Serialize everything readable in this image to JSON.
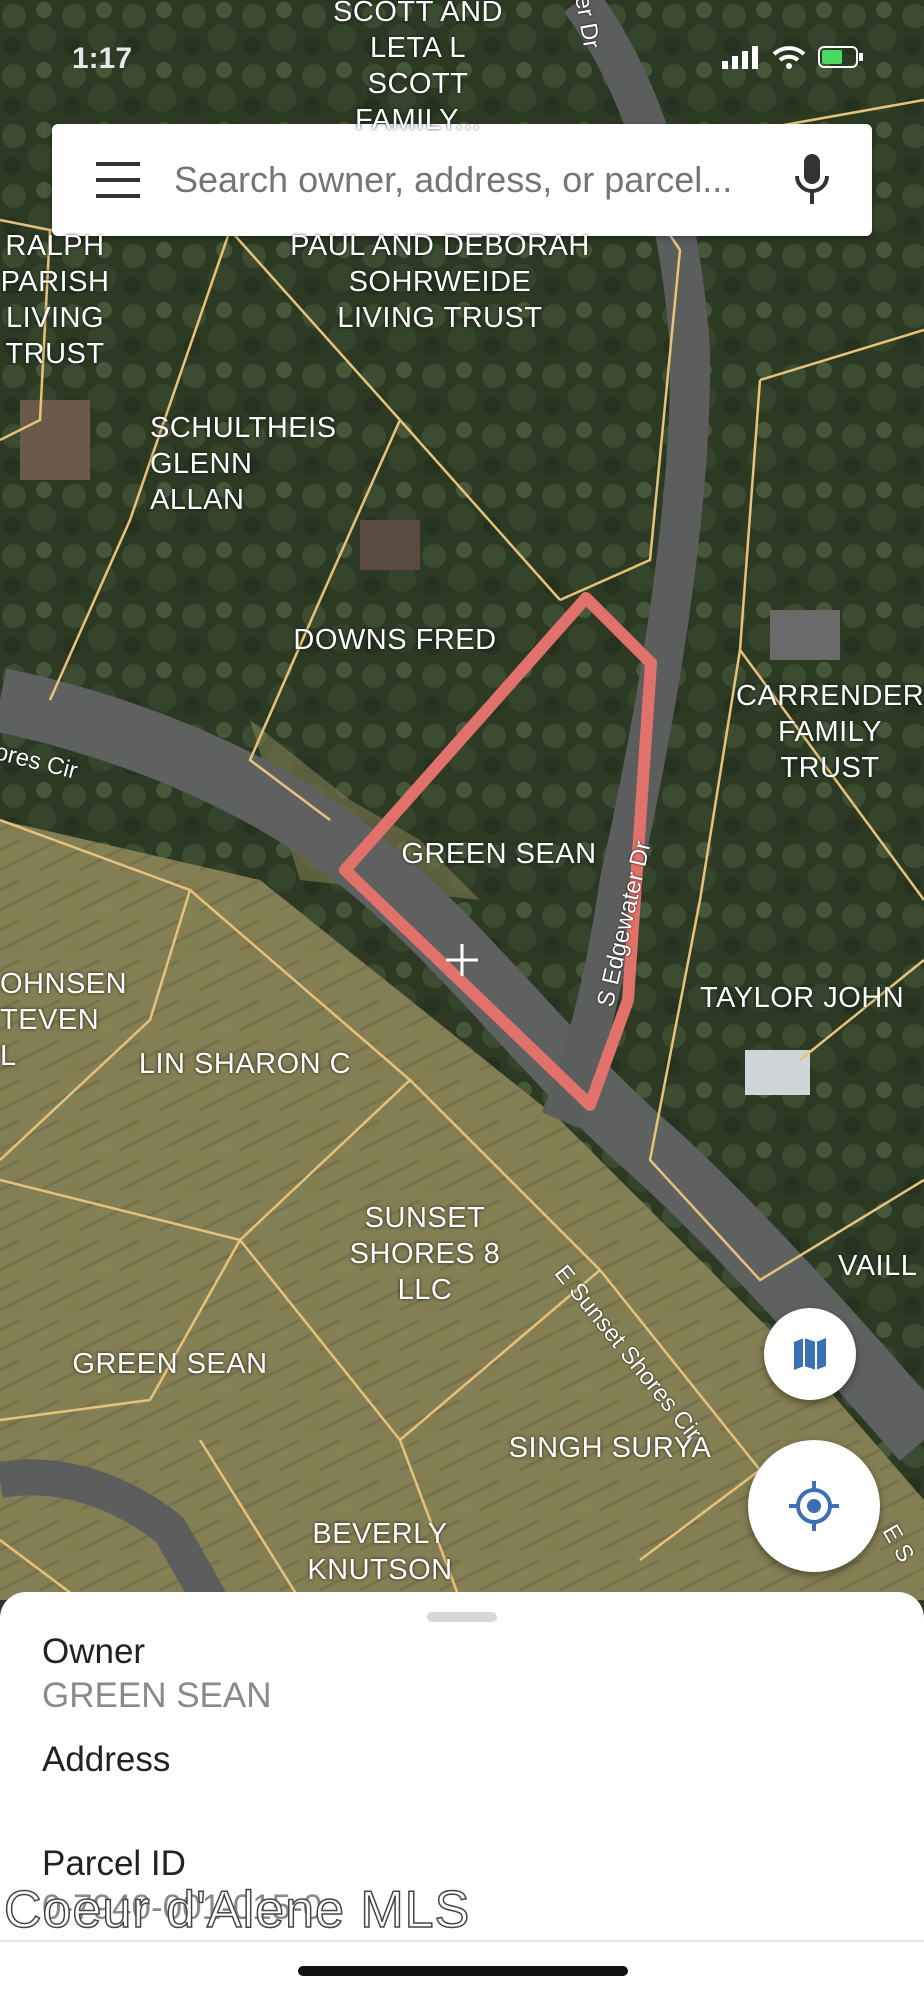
{
  "status_bar": {
    "time": "1:17"
  },
  "search": {
    "placeholder": "Search owner, address, or parcel..."
  },
  "parcels": [
    {
      "id": "scott",
      "text": "SCOTT AND\nLETA L\nSCOTT\nFAMILY..."
    },
    {
      "id": "ralph",
      "text": "RALPH\nPARISH\nLIVING\nTRUST"
    },
    {
      "id": "sohrweide",
      "text": "PAUL AND DEBORAH\nSOHRWEIDE\nLIVING TRUST"
    },
    {
      "id": "schultheis",
      "text": "SCHULTHEIS\nGLENN\nALLAN"
    },
    {
      "id": "downs",
      "text": "DOWNS FRED"
    },
    {
      "id": "carrender",
      "text": "CARRENDER\nFAMILY\nTRUST"
    },
    {
      "id": "green-selected",
      "text": "GREEN SEAN"
    },
    {
      "id": "johnsen",
      "text": "OHNSEN\nTEVEN L"
    },
    {
      "id": "lin",
      "text": "LIN SHARON C"
    },
    {
      "id": "taylor",
      "text": "TAYLOR JOHN"
    },
    {
      "id": "sunset",
      "text": "SUNSET\nSHORES 8\nLLC"
    },
    {
      "id": "vaill",
      "text": "VAILL"
    },
    {
      "id": "green-2",
      "text": "GREEN SEAN"
    },
    {
      "id": "singh",
      "text": "SINGH SURYA"
    },
    {
      "id": "beverly",
      "text": "BEVERLY\nKNUTSON"
    }
  ],
  "roads": {
    "shores_cir": "ores Cir",
    "edgewater": "S Edgewater Dr",
    "edgewater_top": "er Dr",
    "sunset_cir": "E Sunset Shores Cir",
    "e_right": "E S"
  },
  "sheet": {
    "owner_label": "Owner",
    "owner_value": "GREEN SEAN",
    "address_label": "Address",
    "address_value": "",
    "parcel_label": "Parcel ID",
    "parcel_value": "0-7940-001-015-0"
  },
  "watermark": "Coeur d'Alene MLS",
  "colors": {
    "parcel_line": "#e8c27a",
    "selected_parcel": "#e0716b",
    "accent_blue": "#3b6fb6"
  }
}
